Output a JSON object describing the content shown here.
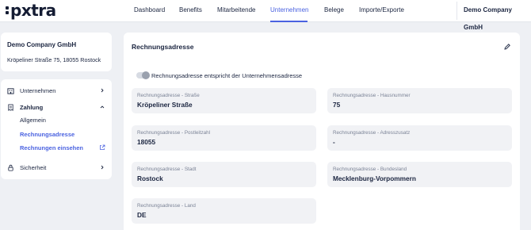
{
  "brand": {
    "logo_text": "pxtra",
    "accent_color": "#4a62e0"
  },
  "topnav": {
    "items": [
      {
        "label": "Dashboard",
        "active": false
      },
      {
        "label": "Benefits",
        "active": false
      },
      {
        "label": "Mitarbeitende",
        "active": false
      },
      {
        "label": "Unternehmen",
        "active": true
      },
      {
        "label": "Belege",
        "active": false
      },
      {
        "label": "Importe/Exporte",
        "active": false
      }
    ],
    "company_switch": "Demo Company GmbH"
  },
  "sidebar": {
    "company_name": "Demo Company GmbH",
    "company_address": "Kröpeliner Straße 75, 18055 Rostock",
    "menu": {
      "unternehmen": {
        "label": "Unternehmen",
        "icon": "building-icon"
      },
      "zahlung": {
        "label": "Zahlung",
        "icon": "receipt-icon",
        "expanded": true
      },
      "allgemein": {
        "label": "Allgemein"
      },
      "rechnungsadresse": {
        "label": "Rechnungsadresse",
        "active": true
      },
      "rechnungen": {
        "label": "Rechnungen einsehen",
        "icon": "external-link-icon"
      },
      "sicherheit": {
        "label": "Sicherheit",
        "icon": "lock-icon"
      }
    }
  },
  "main": {
    "title": "Rechnungsadresse",
    "toggle_label": "Rechnungsadresse entspricht der Unternehmensadresse",
    "toggle_on": false,
    "fields": [
      {
        "label": "Rechnungsadresse - Straße",
        "value": "Kröpeliner Straße"
      },
      {
        "label": "Rechnungsadresse - Hausnummer",
        "value": "75"
      },
      {
        "label": "Rechnungsadresse - Postleitzahl",
        "value": "18055"
      },
      {
        "label": "Rechnungsadresse - Adresszusatz",
        "value": "-"
      },
      {
        "label": "Rechnungsadresse - Stadt",
        "value": "Rostock"
      },
      {
        "label": "Rechnungsadresse - Bundesland",
        "value": "Mecklenburg-Vorpommern"
      },
      {
        "label": "Rechnungsadresse - Land",
        "value": "DE"
      }
    ]
  }
}
